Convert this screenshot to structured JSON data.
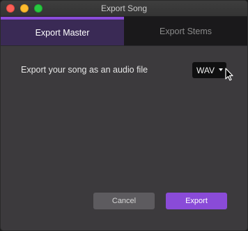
{
  "window": {
    "title": "Export Song"
  },
  "tabs": [
    {
      "label": "Export Master",
      "active": true
    },
    {
      "label": "Export Stems",
      "active": false
    }
  ],
  "main": {
    "prompt": "Export your song as an audio file",
    "format_select": {
      "value": "WAV"
    }
  },
  "footer": {
    "cancel_label": "Cancel",
    "export_label": "Export"
  },
  "colors": {
    "accent": "#8a4bd8",
    "active_tab_bg": "#3a2a55",
    "window_bg": "#3c3a3d"
  }
}
